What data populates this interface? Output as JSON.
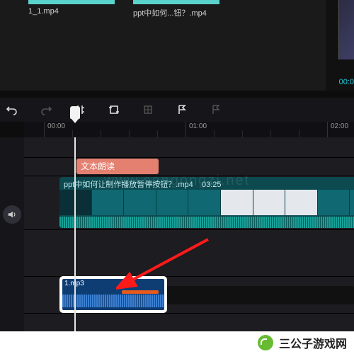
{
  "media": {
    "clips": [
      {
        "filename": "1_1.mp4"
      },
      {
        "filename": "ppt中如何...钮？.mp4"
      }
    ],
    "preview_time": "00:0"
  },
  "toolbar": {
    "undo": "↶",
    "redo": "↷",
    "split": "][",
    "crop": "◻",
    "freeze": "❄",
    "flag": "⚑",
    "flag2": "⚐"
  },
  "ruler": {
    "marks": [
      "00:00",
      "01:00",
      "02:00"
    ]
  },
  "timeline": {
    "label_clip": "文本朗读",
    "video_clip": {
      "title": "ppt中如何让制作播放暂停按钮？.mp4",
      "duration": "03:25"
    },
    "audio_clip": {
      "filename": "1.mp3"
    },
    "mute_icon": "🔈"
  },
  "watermark": "www.sangongzi.net",
  "brand": {
    "text": "三公子游戏网"
  }
}
